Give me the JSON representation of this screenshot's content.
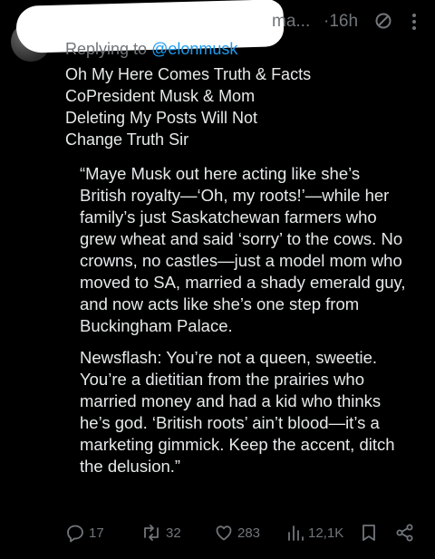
{
  "header": {
    "handle_fragment": "ma...",
    "time": "·16h"
  },
  "reply": {
    "prefix": "Replying to ",
    "mention": "@elonmusk"
  },
  "comment_lines": [
    "Oh My Here Comes Truth & Facts",
    "CoPresident Musk & Mom",
    "Deleting My Posts Will Not",
    "Change Truth Sir"
  ],
  "quote": {
    "paragraph1": [
      "“Maye Musk out here acting like she’s",
      "British royalty—‘Oh, my roots!’—while her",
      "family’s just Saskatchewan farmers who",
      "grew wheat and said ‘sorry’ to the cows. No",
      "crowns, no castles—just a model mom who",
      "moved to SA, married a shady emerald guy,",
      "and now acts like she’s one step from",
      "Buckingham Palace."
    ],
    "paragraph2": [
      "Newsflash: You’re not a queen, sweetie.",
      "You’re a dietitian from the prairies who",
      "married money and had a kid who thinks",
      "he’s god. ‘British roots’ ain’t blood—it’s a",
      "marketing gimmick. Keep the accent, ditch",
      "the delusion.”"
    ]
  },
  "actions": {
    "replies": "17",
    "reposts": "32",
    "likes": "283",
    "views": "12,1K"
  },
  "icons": [
    "no-reply-icon",
    "more-icon",
    "reply-icon",
    "repost-icon",
    "like-icon",
    "views-icon",
    "bookmark-icon",
    "share-icon"
  ],
  "colors": {
    "background": "#000000",
    "text": "#e7e9ea",
    "muted": "#71767b",
    "link": "#1d9bf0"
  }
}
